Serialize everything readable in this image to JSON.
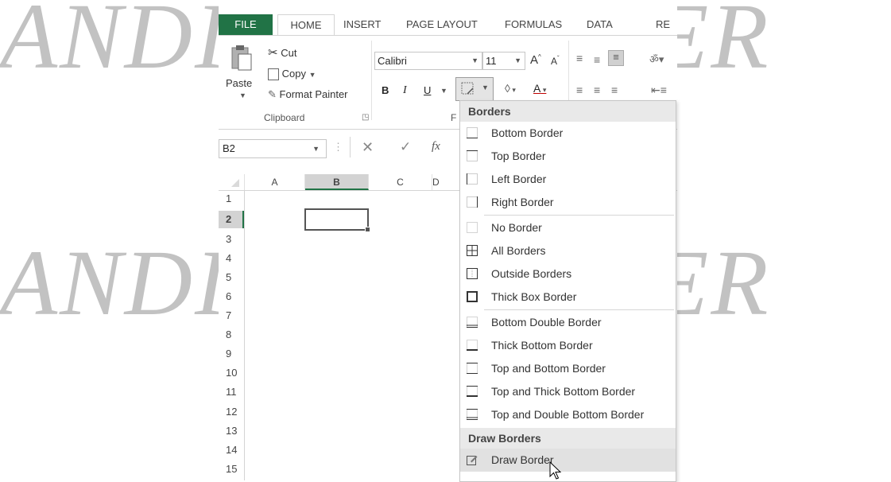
{
  "watermark": {
    "text": "ANDI PUBLISHER"
  },
  "ribbon": {
    "tabs": [
      "FILE",
      "HOME",
      "INSERT",
      "PAGE LAYOUT",
      "FORMULAS",
      "DATA",
      "RE"
    ],
    "clipboard": {
      "paste": "Paste",
      "cut": "Cut",
      "copy": "Copy",
      "format_painter": "Format Painter",
      "group_label": "Clipboard"
    },
    "font": {
      "family": "Calibri",
      "size": "11",
      "bold": "B",
      "italic": "I",
      "underline": "U",
      "group_label_fragment": "F"
    }
  },
  "formula_bar": {
    "name_box": "B2",
    "fx": "fx"
  },
  "grid": {
    "columns": [
      "A",
      "B",
      "C",
      "D"
    ],
    "rows": [
      "1",
      "2",
      "3",
      "4",
      "5",
      "6",
      "7",
      "8",
      "9",
      "10",
      "11",
      "12",
      "13",
      "14",
      "15"
    ],
    "selected_cell": "B2"
  },
  "menu": {
    "section_borders": "Borders",
    "section_draw": "Draw Borders",
    "items_top": [
      "Bottom Border",
      "Top Border",
      "Left Border",
      "Right Border"
    ],
    "items_mid": [
      "No Border",
      "All Borders",
      "Outside Borders",
      "Thick Box Border"
    ],
    "items_bot": [
      "Bottom Double Border",
      "Thick Bottom Border",
      "Top and Bottom Border",
      "Top and Thick Bottom Border",
      "Top and Double Bottom Border"
    ],
    "draw_item": "Draw Border"
  },
  "colors": {
    "accent": "#217346"
  }
}
